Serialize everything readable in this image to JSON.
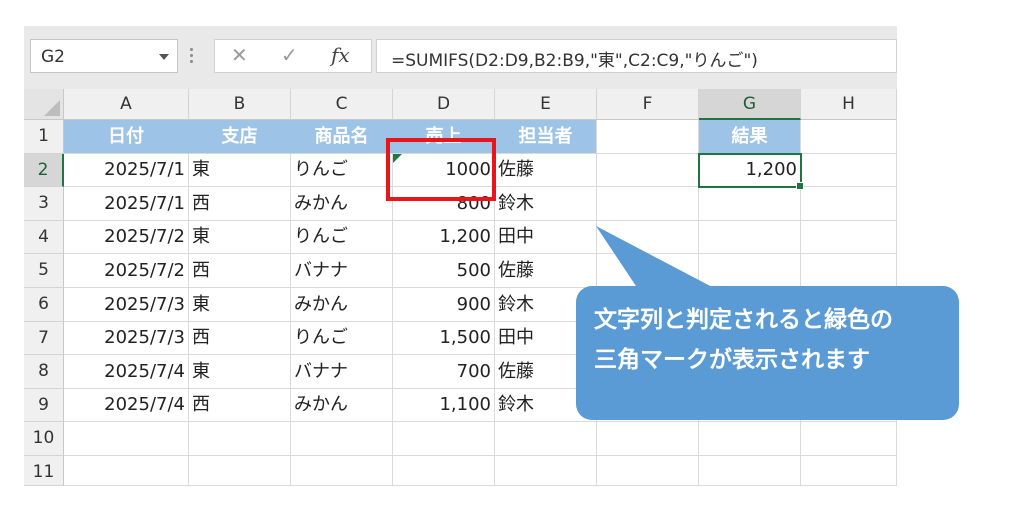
{
  "name_box": {
    "value": "G2"
  },
  "formula_bar": {
    "cancel_icon": "✕",
    "enter_icon": "✓",
    "fx_label": "fx",
    "formula": "=SUMIFS(D2:D9,B2:B9,\"東\",C2:C9,\"りんご\")"
  },
  "columns": [
    "A",
    "B",
    "C",
    "D",
    "E",
    "F",
    "G",
    "H"
  ],
  "rows": [
    "1",
    "2",
    "3",
    "4",
    "5",
    "6",
    "7",
    "8",
    "9",
    "10",
    "11"
  ],
  "selected_cell": {
    "column": "G",
    "row": "2"
  },
  "table": {
    "headers": [
      "日付",
      "支店",
      "商品名",
      "売上",
      "担当者"
    ],
    "data": [
      [
        "2025/7/1",
        "東",
        "りんご",
        "1000",
        "佐藤"
      ],
      [
        "2025/7/1",
        "西",
        "みかん",
        "800",
        "鈴木"
      ],
      [
        "2025/7/2",
        "東",
        "りんご",
        "1,200",
        "田中"
      ],
      [
        "2025/7/2",
        "西",
        "バナナ",
        "500",
        "佐藤"
      ],
      [
        "2025/7/3",
        "東",
        "みかん",
        "900",
        "鈴木"
      ],
      [
        "2025/7/3",
        "西",
        "りんご",
        "1,500",
        "田中"
      ],
      [
        "2025/7/4",
        "東",
        "バナナ",
        "700",
        "佐藤"
      ],
      [
        "2025/7/4",
        "西",
        "みかん",
        "1,100",
        "鈴木"
      ]
    ]
  },
  "result": {
    "header": "結果",
    "value": "1,200"
  },
  "callout": {
    "line1": "文字列と判定されると緑色の",
    "line2": "三角マークが表示されます"
  },
  "colors": {
    "header_fill": "#9dc3e6",
    "callout_fill": "#5b9bd5",
    "highlight_box": "#e8151b",
    "selection": "#217346",
    "text_triangle": "#1e7b3c"
  }
}
